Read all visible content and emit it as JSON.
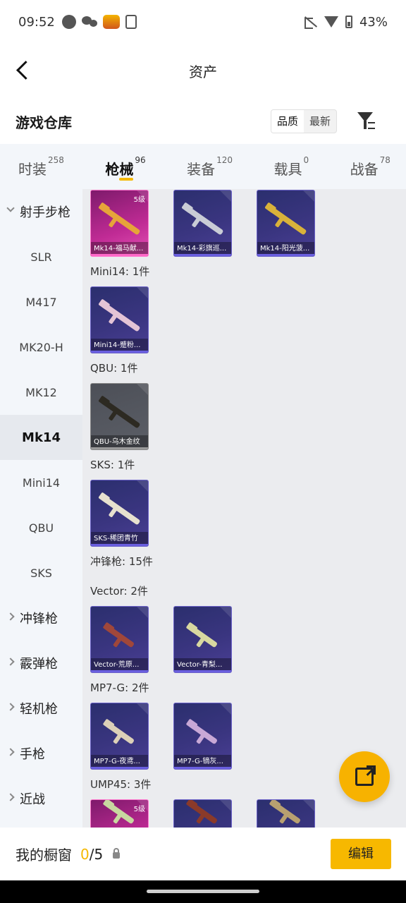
{
  "status_bar": {
    "time": "09:52",
    "battery": "43%"
  },
  "header": {
    "title": "资产"
  },
  "section": {
    "title": "游戏仓库",
    "sort_options": [
      "品质",
      "最新"
    ]
  },
  "tabs": [
    {
      "label": "时装",
      "count": "258"
    },
    {
      "label": "枪械",
      "count": "96"
    },
    {
      "label": "装备",
      "count": "120"
    },
    {
      "label": "载具",
      "count": "0"
    },
    {
      "label": "战备",
      "count": "78"
    }
  ],
  "sidebar": {
    "items": [
      {
        "label": "射手步枪"
      },
      {
        "label": "SLR"
      },
      {
        "label": "M417"
      },
      {
        "label": "MK20-H"
      },
      {
        "label": "MK12"
      },
      {
        "label": "Mk14"
      },
      {
        "label": "Mini14"
      },
      {
        "label": "QBU"
      },
      {
        "label": "SKS"
      },
      {
        "label": "冲锋枪"
      },
      {
        "label": "霰弹枪"
      },
      {
        "label": "轻机枪"
      },
      {
        "label": "手枪"
      },
      {
        "label": "近战"
      }
    ]
  },
  "content": {
    "mk14_items": [
      {
        "label": "Mk14-福马献...",
        "level": "5级"
      },
      {
        "label": "Mk14-彩旗巡..."
      },
      {
        "label": "Mk14-阳光菠..."
      }
    ],
    "mini14_title": "Mini14: 1件",
    "mini14_items": [
      {
        "label": "Mini14-蹙粉..."
      }
    ],
    "qbu_title": "QBU: 1件",
    "qbu_items": [
      {
        "label": "QBU-乌木金纹"
      }
    ],
    "sks_title": "SKS: 1件",
    "sks_items": [
      {
        "label": "SKS-稀团青竹"
      }
    ],
    "smg_title": "冲锋枪: 15件",
    "vector_title": "Vector: 2件",
    "vector_items": [
      {
        "label": "Vector-荒原..."
      },
      {
        "label": "Vector-青梨..."
      }
    ],
    "mp7_title": "MP7-G: 2件",
    "mp7_items": [
      {
        "label": "MP7-G-夜鸢..."
      },
      {
        "label": "MP7-G-镝灰..."
      }
    ],
    "ump_title": "UMP45: 3件",
    "ump_items": [
      {
        "level": "5级"
      }
    ]
  },
  "bottom_bar": {
    "showcase_label": "我的橱窗",
    "current": "0",
    "total": "/5",
    "edit_label": "编辑"
  },
  "colors": {
    "accent": "#f5b800",
    "epic_card": "#3a3580",
    "legendary_card": "#c02b95"
  }
}
